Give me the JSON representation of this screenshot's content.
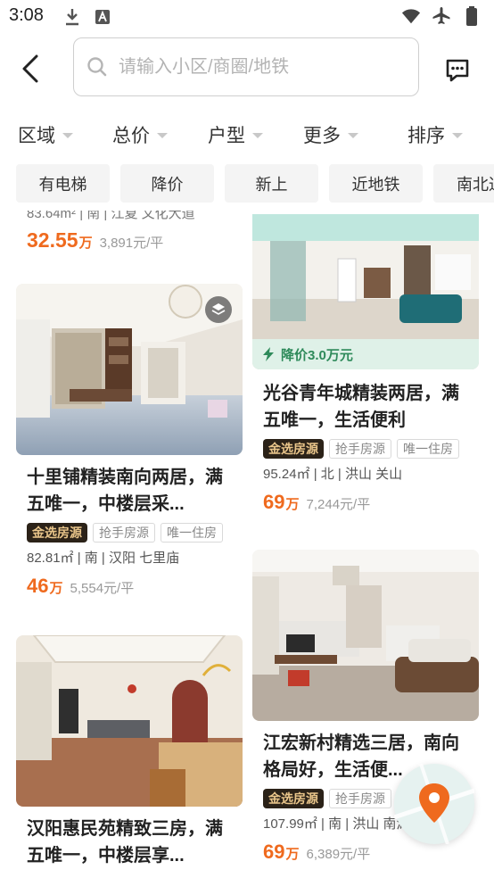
{
  "status": {
    "time": "3:08"
  },
  "search": {
    "placeholder": "请输入小区/商圈/地铁"
  },
  "filters": [
    "区域",
    "总价",
    "户型",
    "更多",
    "排序"
  ],
  "tags": [
    "有电梯",
    "降价",
    "新上",
    "近地铁",
    "南北通"
  ],
  "listings": {
    "top_partial": {
      "meta": "83.64m² | 南 | 江夏 文化大道",
      "price": "32.55",
      "price_unit": "万",
      "unit_price": "3,891元/平"
    },
    "shiliPu": {
      "title": "十里铺精装南向两居，满五唯一，中楼层采...",
      "badge_gold": "金选房源",
      "badge_1": "抢手房源",
      "badge_2": "唯一住房",
      "meta": "82.81㎡ | 南 | 汉阳 七里庙",
      "price": "46",
      "price_unit": "万",
      "unit_price": "5,554元/平"
    },
    "guanggu": {
      "drop_label": "降价3.0万元",
      "title": "光谷青年城精装两居，满五唯一，生活便利",
      "badge_gold": "金选房源",
      "badge_1": "抢手房源",
      "badge_2": "唯一住房",
      "meta": "95.24㎡ | 北 | 洪山 关山",
      "price": "69",
      "price_unit": "万",
      "unit_price": "7,244元/平"
    },
    "jianghong": {
      "title": "江宏新村精选三居，南向格局好，生活便...",
      "badge_gold": "金选房源",
      "badge_1": "抢手房源",
      "meta": "107.99㎡ | 南 | 洪山 南湖",
      "price": "69",
      "price_unit": "万",
      "unit_price": "6,389元/平"
    },
    "hanyang": {
      "title": "汉阳惠民苑精致三房，满五唯一，中楼层享..."
    }
  },
  "colors": {
    "accent_orange": "#ef6a1e",
    "gold_badge_bg": "#2b2218",
    "drop_green": "#2e8a5a"
  }
}
